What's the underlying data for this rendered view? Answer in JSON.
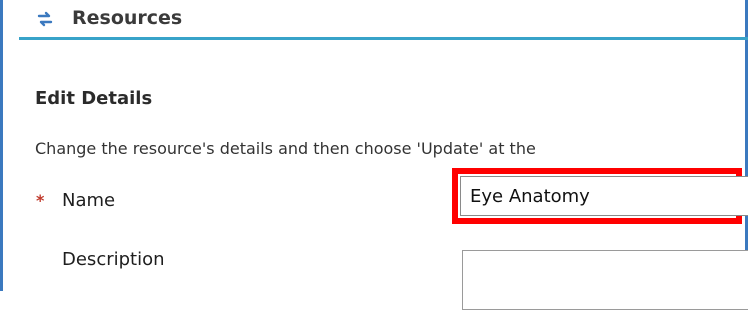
{
  "header": {
    "title": "Resources",
    "icon": "refresh-arrows-icon",
    "accent_color": "#38a3c9",
    "frame_color": "#3b79bf"
  },
  "form": {
    "section_title": "Edit Details",
    "instructions": "Change the resource's details and then choose 'Update' at the",
    "required_marker": "*",
    "fields": {
      "name": {
        "label": "Name",
        "value": "Eye Anatomy",
        "highlight_color": "#ff0000"
      },
      "description": {
        "label": "Description",
        "value": ""
      }
    }
  }
}
